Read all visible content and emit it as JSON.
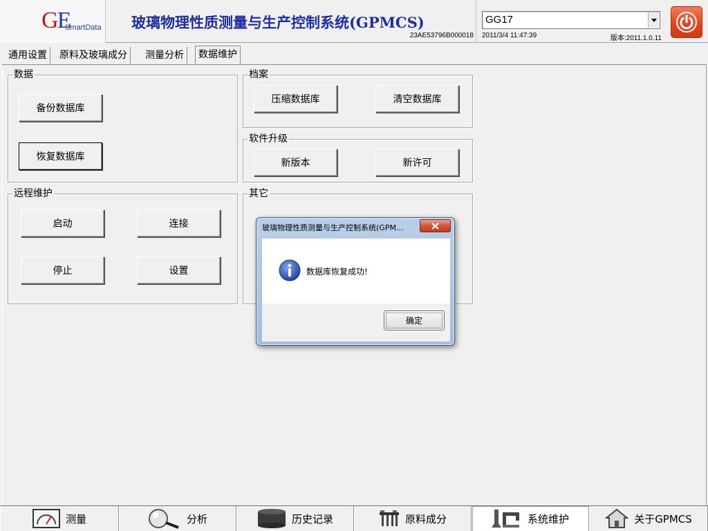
{
  "header": {
    "logo_letters_g": "G",
    "logo_letters_e": "E",
    "logo_sub": "SmartData",
    "title": "玻璃物理性质测量与生产控制系统(GPMCS)",
    "serial": "23AE53796B000018",
    "product_select_value": "GG17",
    "datetime": "2011/3/4 11:47:39",
    "version": "版本:2011.1.0.11",
    "power_icon": "power-icon"
  },
  "tabs": [
    {
      "label": "通用设置"
    },
    {
      "label": "原料及玻璃成分"
    },
    {
      "label": "测量分析"
    },
    {
      "label": "数据维护",
      "active": true
    }
  ],
  "groups": {
    "data": {
      "title": "数据",
      "backup": "备份数据库",
      "restore": "恢复数据库"
    },
    "archive": {
      "title": "档案",
      "compress": "压缩数据库",
      "clear": "清空数据库"
    },
    "upgrade": {
      "title": "软件升级",
      "new_version": "新版本",
      "new_license": "新许可"
    },
    "remote": {
      "title": "远程维护",
      "start": "启动",
      "connect": "连接",
      "stop": "停止",
      "settings": "设置"
    },
    "other": {
      "title": "其它"
    }
  },
  "dialog": {
    "title": "玻璃物理性质测量与生产控制系统(GPM...",
    "message": "数据库恢复成功!",
    "ok": "确定",
    "icon": "info-icon"
  },
  "bottom_nav": [
    {
      "label": "测量",
      "icon": "gauge-icon"
    },
    {
      "label": "分析",
      "icon": "magnifier-icon"
    },
    {
      "label": "历史记录",
      "icon": "database-icon"
    },
    {
      "label": "原料成分",
      "icon": "materials-icon"
    },
    {
      "label": "系统维护",
      "icon": "tools-icon",
      "active": true
    },
    {
      "label": "关于GPMCS",
      "icon": "home-icon"
    }
  ],
  "colors": {
    "title_blue": "#1f2ea8",
    "logo_red": "#c8141e",
    "logo_blue": "#1f3f9f",
    "power_orange": "#e2471f",
    "background": "#f0f0f0"
  }
}
